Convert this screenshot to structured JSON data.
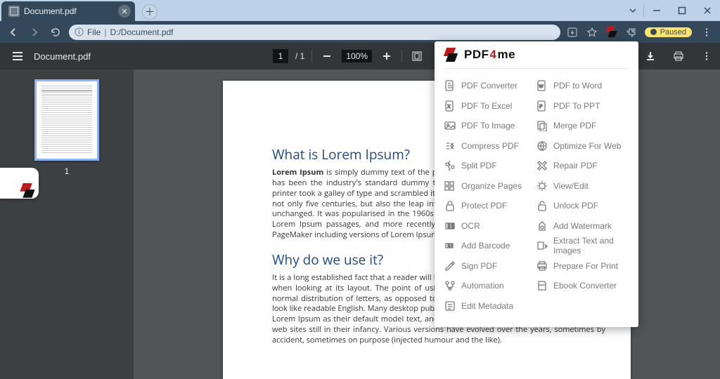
{
  "browser": {
    "tab_title": "Document.pdf",
    "url_protocol_label": "File",
    "url_path": "D:/Document.pdf",
    "status_paused": "Paused"
  },
  "pdf": {
    "doc_name": "Document.pdf",
    "current_page": "1",
    "total_pages": "/ 1",
    "zoom": "100%",
    "thumb_label": "1",
    "h1": "What is Lorem Ipsum?",
    "p1": "Lorem Ipsum is simply dummy text of the printing and typesetting industry. Lorem Ipsum has been the industry's standard dummy text ever since the 1500s, when an unknown printer took a galley of type and scrambled it to make a type specimen book. It has survived not only five centuries, but also the leap into electronic typesetting, remaining essentially unchanged. It was popularised in the 1960s with the release of Letraset sheets containing Lorem Ipsum passages, and more recently with desktop publishing software like Aldus PageMaker including versions of Lorem Ipsum.",
    "h2": "Why do we use it?",
    "p2": "It is a long established fact that a reader will be distracted by the readable content of a page when looking at its layout. The point of using Lorem Ipsum is that it has a more-or-less normal distribution of letters, as opposed to using 'Content here, content here', making it look like readable English. Many desktop publishing packages and web page editors now use Lorem Ipsum as their default model text, and a search for 'lorem ipsum' will uncover many web sites still in their infancy. Various versions have evolved over the years, sometimes by accident, sometimes on purpose (injected humour and the like)."
  },
  "popup": {
    "brand": "PDF4me",
    "left": [
      "PDF Converter",
      "PDF To Excel",
      "PDF To Image",
      "Compress PDF",
      "Split PDF",
      "Organize Pages",
      "Protect PDF",
      "OCR",
      "Add Barcode",
      "Sign PDF",
      "Automation",
      "Edit Metadata"
    ],
    "right": [
      "PDF to Word",
      "PDF To PPT",
      "Merge PDF",
      "Optimize For Web",
      "Repair PDF",
      "View/Edit",
      "Unlock PDF",
      "Add Watermark",
      "Extract Text and Images",
      "Prepare For Print",
      "Ebook Converter"
    ]
  }
}
